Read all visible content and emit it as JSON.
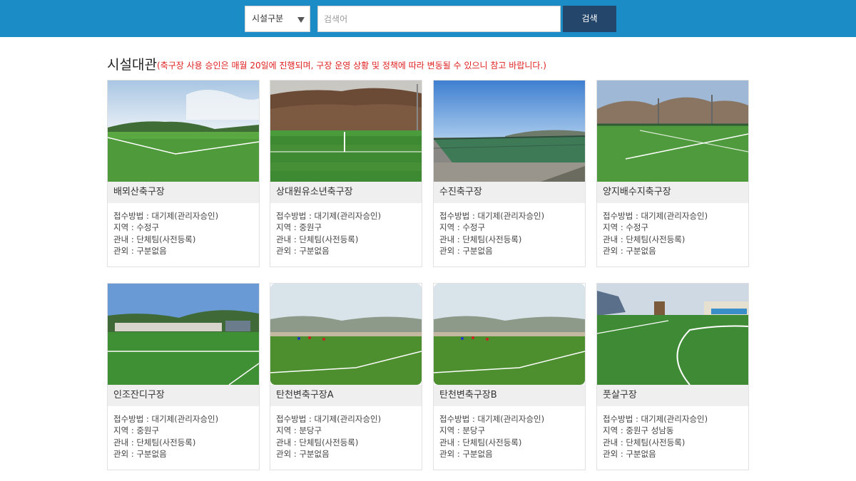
{
  "search": {
    "category_label": "시설구분",
    "placeholder": "검색어",
    "button_label": "검색"
  },
  "page": {
    "title": "시설대관",
    "notice": "(축구장 사용 승인은 매월 20일에 진행되며, 구장 운영 상황 및 정책에 따라 변동될 수 있으니 참고 바랍니다.)"
  },
  "colors": {
    "header_bar": "#1b8cc5",
    "search_button": "#24466b",
    "notice_text": "#e02020",
    "card_name_bg": "#efefef"
  },
  "facilities": [
    {
      "name": "배뫼산축구장",
      "method": "접수방법 : 대기제(관리자승인)",
      "region": "지역 : 수정구",
      "inner": "관내 : 단체팀(사전등록)",
      "outer": "관외 : 구분없음"
    },
    {
      "name": "상대원유소년축구장",
      "method": "접수방법 : 대기제(관리자승인)",
      "region": "지역 : 중원구",
      "inner": "관내 : 단체팀(사전등록)",
      "outer": "관외 : 구분없음"
    },
    {
      "name": "수진축구장",
      "method": "접수방법 : 대기제(관리자승인)",
      "region": "지역 : 수정구",
      "inner": "관내 : 단체팀(사전등록)",
      "outer": "관외 : 구분없음"
    },
    {
      "name": "양지배수지축구장",
      "method": "접수방법 : 대기제(관리자승인)",
      "region": "지역 : 수정구",
      "inner": "관내 : 단체팀(사전등록)",
      "outer": "관외 : 구분없음"
    },
    {
      "name": "인조잔디구장",
      "method": "접수방법 : 대기제(관리자승인)",
      "region": "지역 : 중원구",
      "inner": "관내 : 단체팀(사전등록)",
      "outer": "관외 : 구분없음"
    },
    {
      "name": "탄천변축구장A",
      "method": "접수방법 : 대기제(관리자승인)",
      "region": "지역 : 분당구",
      "inner": "관내 : 단체팀(사전등록)",
      "outer": "관외 : 구분없음"
    },
    {
      "name": "탄천변축구장B",
      "method": "접수방법 : 대기제(관리자승인)",
      "region": "지역 : 분당구",
      "inner": "관내 : 단체팀(사전등록)",
      "outer": "관외 : 구분없음"
    },
    {
      "name": "풋살구장",
      "method": "접수방법 : 대기제(관리자승인)",
      "region": "지역 : 중원구 성남동",
      "inner": "관내 : 단체팀(사전등록)",
      "outer": "관외 : 구분없음"
    }
  ]
}
